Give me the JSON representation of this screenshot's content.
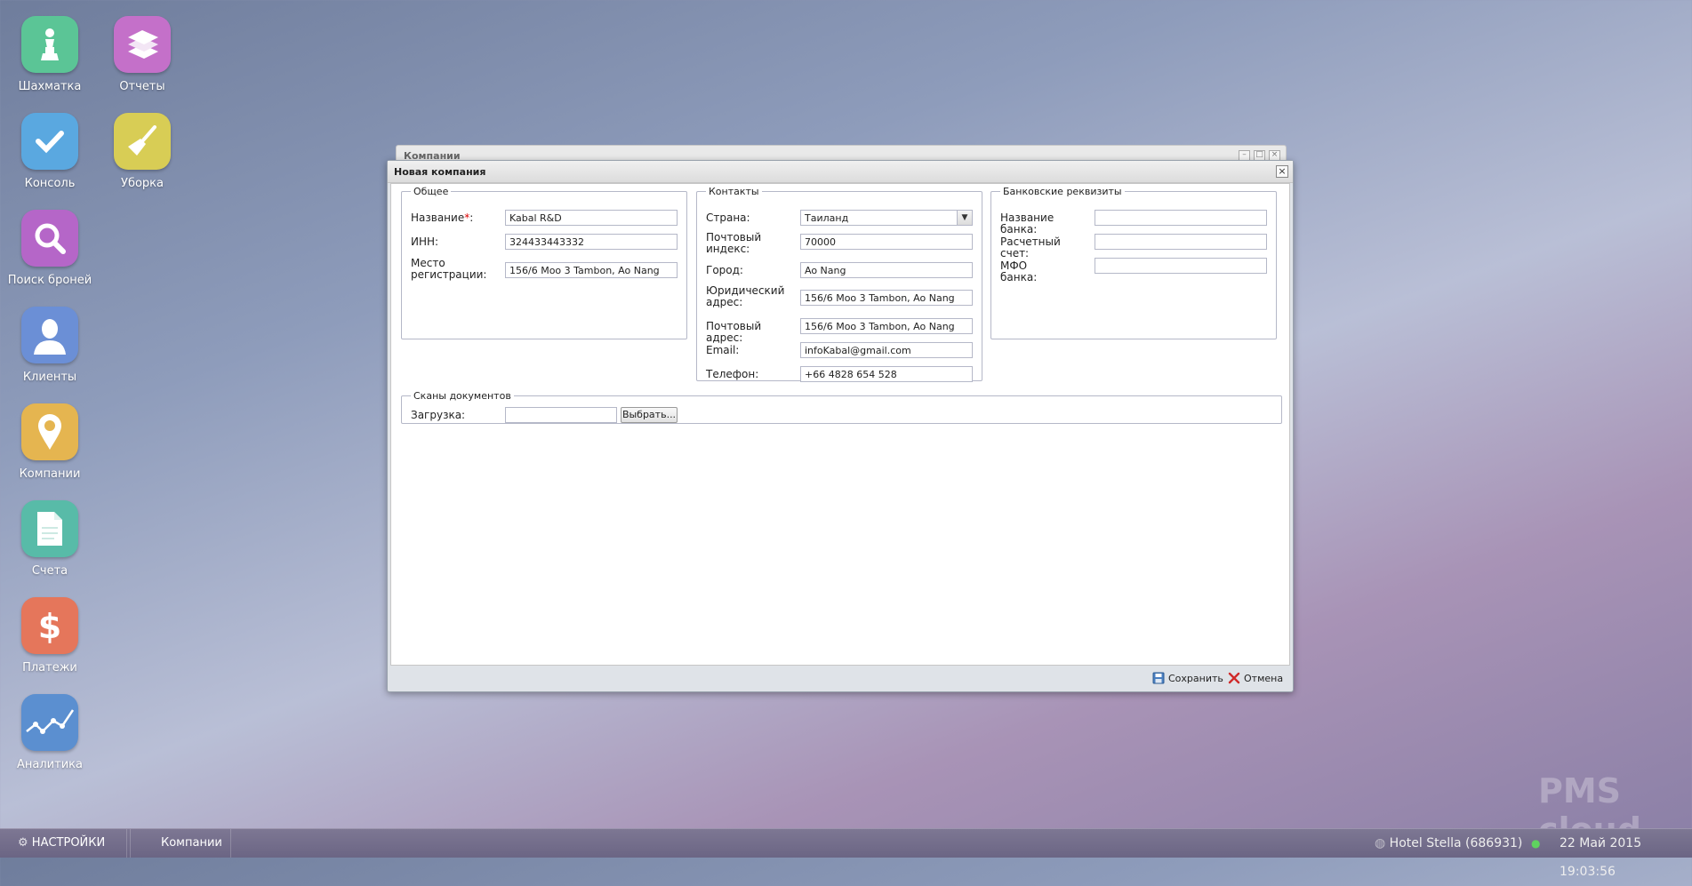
{
  "desktop": {
    "icons": [
      {
        "label": "Шахматка",
        "icon": "chess-pawn-icon",
        "color": "#5bc596"
      },
      {
        "label": "Отчеты",
        "icon": "books-icon",
        "color": "#c470c9"
      },
      {
        "label": "Консоль",
        "icon": "checkmark-icon",
        "color": "#5aa8e0"
      },
      {
        "label": "Уборка",
        "icon": "broom-icon",
        "color": "#d8cd55"
      },
      {
        "label": "Поиск броней",
        "icon": "magnifier-icon",
        "color": "#b566c8"
      },
      {
        "label": "Клиенты",
        "icon": "user-icon",
        "color": "#6b8fd6"
      },
      {
        "label": "Компании",
        "icon": "map-pin-icon",
        "color": "#e5b550"
      },
      {
        "label": "Счета",
        "icon": "document-icon",
        "color": "#58bba8"
      },
      {
        "label": "Платежи",
        "icon": "dollar-icon",
        "color": "#e5765b"
      },
      {
        "label": "Аналитика",
        "icon": "line-chart-icon",
        "color": "#5b8fd0"
      }
    ]
  },
  "bg_window": {
    "title": "Компании"
  },
  "dialog": {
    "title": "Новая компания",
    "general": {
      "legend": "Общее",
      "name_label": "Название",
      "name_required": "*",
      "name_colon": ":",
      "name_value": "Kabal R&D",
      "inn_label": "ИНН:",
      "inn_value": "324433443332",
      "place_label_1": "Место",
      "place_label_2": "регистрации:",
      "place_value": "156/6 Moo 3 Tambon, Ao Nang"
    },
    "contacts": {
      "legend": "Контакты",
      "country_label": "Страна:",
      "country_value": "Таиланд",
      "zip_label_1": "Почтовый",
      "zip_label_2": "индекс:",
      "zip_value": "70000",
      "city_label": "Город:",
      "city_value": "Ao Nang",
      "legal_label_1": "Юридический",
      "legal_label_2": "адрес:",
      "legal_value": "156/6 Moo 3 Tambon, Ao Nang",
      "postal_label": "Почтовый адрес:",
      "postal_value": "156/6 Moo 3 Tambon, Ao Nang",
      "email_label": "Email:",
      "email_value": "infoKabal@gmail.com",
      "phone_label": "Телефон:",
      "phone_value": "+66 4828 654 528"
    },
    "bank": {
      "legend": "Банковские реквизиты",
      "bank_name_label": "Название банка:",
      "bank_name_value": "",
      "account_label": "Расчетный счет:",
      "account_value": "",
      "mfo_label": "МФО банка:",
      "mfo_value": ""
    },
    "scans": {
      "legend": "Сканы документов",
      "upload_label": "Загрузка:",
      "upload_value": "",
      "choose_label": "Выбрать..."
    },
    "footer": {
      "save_label": "Сохранить",
      "cancel_label": "Отмена"
    }
  },
  "taskbar": {
    "settings_label": "НАСТРОЙКИ",
    "window_label": "Компании",
    "hotel": "Hotel Stella (686931)",
    "datetime": "22 Май 2015 19:03:56"
  },
  "watermark": {
    "brand": "PMS cloud"
  }
}
